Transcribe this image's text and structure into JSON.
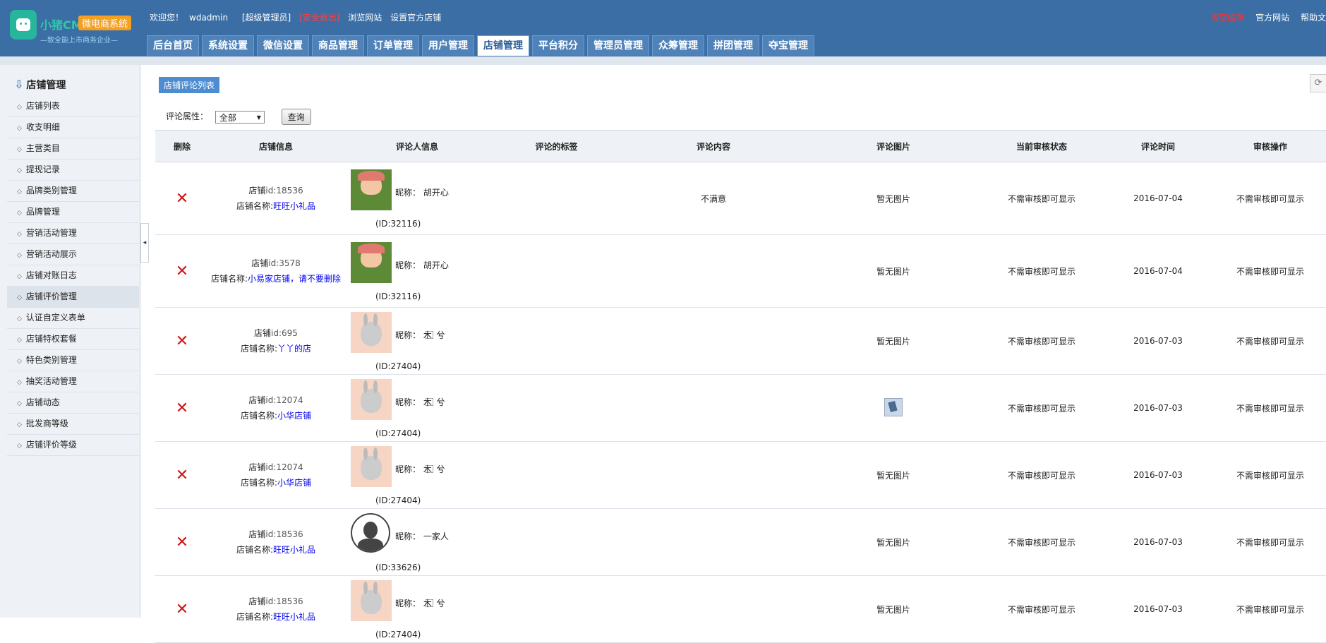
{
  "header": {
    "logo": {
      "brand": "小猪CMS",
      "badge": "微电商系统",
      "slogan": "—致全能上市商务企业—"
    },
    "welcome": "欢迎您！",
    "username": "wdadmin",
    "role": "[超级管理员]",
    "logout": "[安全退出]",
    "browse_site": "浏览网站",
    "set_official_shop": "设置官方店铺",
    "clear_cache": "清空缓存",
    "official_site": "官方网站",
    "help": "帮助文"
  },
  "nav": [
    {
      "label": "后台首页"
    },
    {
      "label": "系统设置"
    },
    {
      "label": "微信设置"
    },
    {
      "label": "商品管理"
    },
    {
      "label": "订单管理"
    },
    {
      "label": "用户管理"
    },
    {
      "label": "店铺管理",
      "active": true
    },
    {
      "label": "平台积分"
    },
    {
      "label": "管理员管理"
    },
    {
      "label": "众筹管理"
    },
    {
      "label": "拼团管理"
    },
    {
      "label": "夺宝管理"
    }
  ],
  "sidebar": {
    "title": "店铺管理",
    "items": [
      "店铺列表",
      "收支明细",
      "主营类目",
      "提现记录",
      "品牌类别管理",
      "品牌管理",
      "营销活动管理",
      "营销活动展示",
      "店铺对账日志",
      "店铺评价管理",
      "认证自定义表单",
      "店铺特权套餐",
      "特色类别管理",
      "抽奖活动管理",
      "店铺动态",
      "批发商等级",
      "店铺评价等级"
    ],
    "active_index": 9
  },
  "breadcrumb": "店铺评论列表",
  "filter": {
    "label": "评论属性：",
    "select_value": "全部",
    "button": "查询"
  },
  "table": {
    "columns": [
      "删除",
      "店铺信息",
      "评论人信息",
      "评论的标签",
      "评论内容",
      "评论图片",
      "当前审核状态",
      "评论时间",
      "审核操作"
    ],
    "rows": [
      {
        "shop_id_prefix": "店铺",
        "shop_id": "id:18536",
        "shop_name_prefix": "店铺名称:",
        "shop_name": "旺旺小礼品",
        "avatar": "bird",
        "nick": "昵称： 胡开心",
        "uid": "(ID:32116)",
        "tags": "",
        "content": "不满意",
        "image": "暂无图片",
        "status": "不需审核即可显示",
        "time": "2016-07-04",
        "op": "不需审核即可显示"
      },
      {
        "shop_id_prefix": "店铺",
        "shop_id": "id:3578",
        "shop_name_prefix": "店铺名称:",
        "shop_name": "小易家店铺，请不要删除",
        "avatar": "bird",
        "nick": "昵称： 胡开心",
        "uid": "(ID:32116)",
        "tags": "",
        "content": "",
        "image": "暂无图片",
        "status": "不需审核即可显示",
        "time": "2016-07-04",
        "op": "不需审核即可显示"
      },
      {
        "shop_id_prefix": "店铺",
        "shop_id": "id:695",
        "shop_name_prefix": "店铺名称:",
        "shop_name": "丫丫的店",
        "avatar": "bunny",
        "nick": "昵称： 木 ⃞ 兮",
        "uid": "(ID:27404)",
        "tags": "",
        "content": "",
        "image": "暂无图片",
        "status": "不需审核即可显示",
        "time": "2016-07-03",
        "op": "不需审核即可显示"
      },
      {
        "shop_id_prefix": "店铺",
        "shop_id": "id:12074",
        "shop_name_prefix": "店铺名称:",
        "shop_name": "小华店铺",
        "avatar": "bunny",
        "nick": "昵称： 木 ⃞ 兮",
        "uid": "(ID:27404)",
        "tags": "",
        "content": "",
        "image": "",
        "has_thumb": true,
        "status": "不需审核即可显示",
        "time": "2016-07-03",
        "op": "不需审核即可显示"
      },
      {
        "shop_id_prefix": "店铺",
        "shop_id": "id:12074",
        "shop_name_prefix": "店铺名称:",
        "shop_name": "小华店铺",
        "avatar": "bunny",
        "nick": "昵称： 木 ⃞ 兮",
        "uid": "(ID:27404)",
        "tags": "",
        "content": "",
        "image": "暂无图片",
        "status": "不需审核即可显示",
        "time": "2016-07-03",
        "op": "不需审核即可显示"
      },
      {
        "shop_id_prefix": "店铺",
        "shop_id": "id:18536",
        "shop_name_prefix": "店铺名称:",
        "shop_name": "旺旺小礼品",
        "avatar": "person",
        "nick": "昵称： 一家人",
        "uid": "(ID:33626)",
        "tags": "",
        "content": "",
        "image": "暂无图片",
        "status": "不需审核即可显示",
        "time": "2016-07-03",
        "op": "不需审核即可显示"
      },
      {
        "shop_id_prefix": "店铺",
        "shop_id": "id:18536",
        "shop_name_prefix": "店铺名称:",
        "shop_name": "旺旺小礼品",
        "avatar": "bunny",
        "nick": "昵称： 木 ⃞ 兮",
        "uid": "(ID:27404)",
        "tags": "",
        "content": "",
        "image": "暂无图片",
        "status": "不需审核即可显示",
        "time": "2016-07-03",
        "op": "不需审核即可显示"
      }
    ]
  },
  "icons": {
    "delete": "close-x-icon",
    "refresh": "refresh-icon",
    "sidebar_title": "down-arrow-icon",
    "collapse": "collapse-left-icon"
  },
  "colors": {
    "header_bg": "#3a6ea5",
    "delete_red": "#d01818",
    "link_blue": "#0000ee",
    "breadcrumb_bg": "#4d8cd0"
  }
}
